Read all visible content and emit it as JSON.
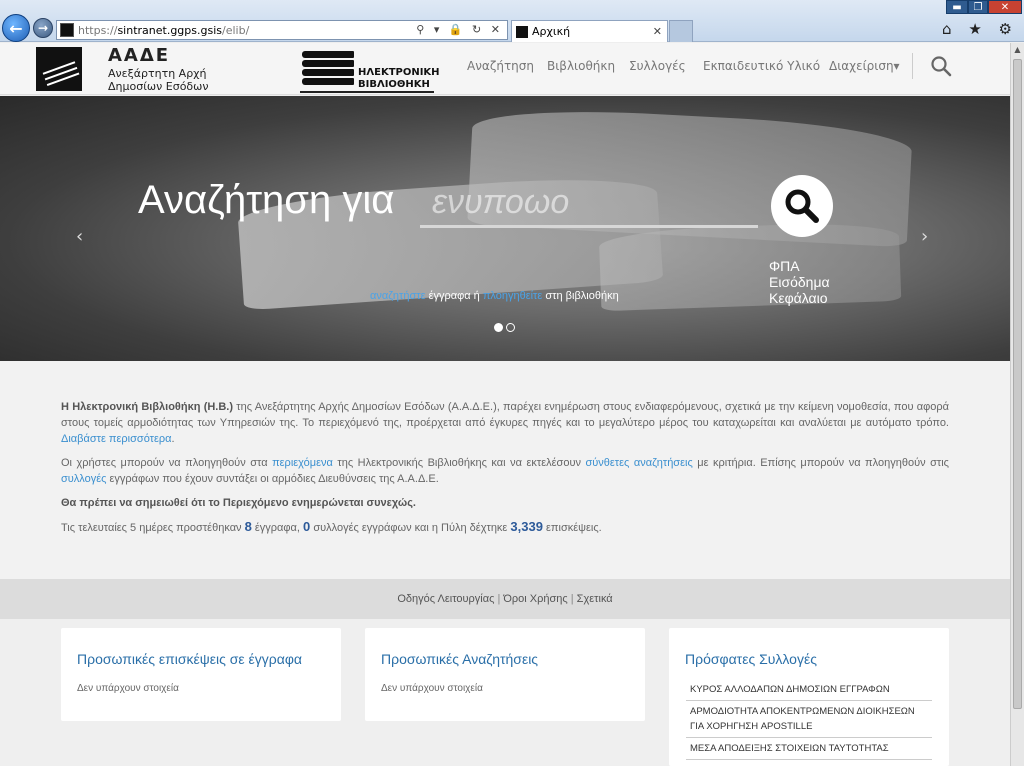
{
  "browser": {
    "url_prefix": "https://",
    "url_host": "sintranet.ggps.gsis",
    "url_path": "/elib/",
    "tab_title": "Αρχική",
    "address_icons": "⚲ ▾ 🔒 ↻ ✕",
    "tab_close": "✕",
    "win_min": "▬",
    "win_max": "❐",
    "win_close": "✕",
    "right_icons": "⌂ ★ ⚙",
    "back_glyph": "←",
    "fwd_glyph": "→"
  },
  "header": {
    "org_abbr": "ΑΑΔΕ",
    "org_name": "Ανεξάρτητη Αρχή Δημοσίων Εσόδων",
    "elib_line1": "ΗΛΕΚΤΡΟΝΙΚΗ",
    "elib_line2": "ΒΙΒΛΙΟΘΗΚΗ",
    "nav": [
      {
        "label": "Αναζήτηση"
      },
      {
        "label": "Βιβλιοθήκη"
      },
      {
        "label": "Συλλογές"
      },
      {
        "label": "Εκπαιδευτικό Υλικό"
      },
      {
        "label": "Διαχείριση"
      }
    ],
    "admin_caret": "▾"
  },
  "hero": {
    "heading": "Αναζήτηση για",
    "input_placeholder": "ενυποωο",
    "tags": [
      "ΦΠΑ",
      "Εισόδημα",
      "Κεφάλαιο"
    ],
    "sub_link1": "αναζητήστε",
    "sub_mid": "έγγραφα ή",
    "sub_link2": "πλοηγηθείτε",
    "sub_end": "στη βιβλιοθήκη",
    "prev": "‹",
    "next": "›",
    "slide_count": 2,
    "active_slide": 1
  },
  "intro": {
    "p1_bold": "Η Ηλεκτρονική Βιβλιοθήκη (Η.Β.)",
    "p1_text": " της Ανεξάρτητης Αρχής Δημοσίων Εσόδων (Α.Α.Δ.Ε.), παρέχει ενημέρωση στους ενδιαφερόμενους, σχετικά με την κείμενη νομοθεσία, που αφορά στους τομείς αρμοδιότητας των Υπηρεσιών της. Το περιεχόμενό της, προέρχεται από έγκυρες πηγές και το μεγαλύτερο μέρος του καταχωρείται και αναλύεται με αυτόματο τρόπο.",
    "p1_link": "Διαβάστε περισσότερα",
    "p1_end": ".",
    "p2_a": "Οι χρήστες μπορούν να πλοηγηθούν στα ",
    "p2_link1": "περιεχόμενα",
    "p2_b": " της Ηλεκτρονικής Βιβλιοθήκης και να εκτελέσουν ",
    "p2_link2": "σύνθετες αναζητήσεις",
    "p2_c": " με κριτήρια. Επίσης μπορούν να πλοηγηθούν στις ",
    "p2_link3": "συλλογές",
    "p2_d": " εγγράφων που έχουν συντάξει οι αρμόδιες Διευθύνσεις της Α.Α.Δ.Ε.",
    "p3_bold": "Θα πρέπει να σημειωθεί ότι το Περιεχόμενο ενημερώνεται συνεχώς.",
    "p4_a": "Τις τελευταίες 5 ημέρες προστέθηκαν ",
    "docs_added": "8",
    "p4_b": " έγγραφα, ",
    "collections_added": "0",
    "p4_c": " συλλογές εγγράφων και η Πύλη δέχτηκε ",
    "visits": "3,339",
    "p4_d": " επισκέψεις."
  },
  "footer_links": {
    "guide": "Οδηγός Λειτουργίας",
    "terms": "Όροι Χρήσης",
    "about": "Σχετικά",
    "sep": "|"
  },
  "cards": {
    "visits_title": "Προσωπικές επισκέψεις σε έγγραφα",
    "visits_empty": "Δεν υπάρχουν στοιχεία",
    "searches_title": "Προσωπικές Αναζητήσεις",
    "searches_empty": "Δεν υπάρχουν στοιχεία",
    "recent_title": "Πρόσφατες Συλλογές",
    "recent_items": [
      {
        "label": "ΚΥΡΟΣ ΑΛΛΟΔΑΠΩΝ ΔΗΜΟΣΙΩΝ ΕΓΓΡΑΦΩΝ"
      },
      {
        "label": "ΑΡΜΟΔΙΟΤΗΤΑ ΑΠΟΚΕΝΤΡΩΜΕΝΩΝ ΔΙΟΙΚΗΣΕΩΝ ΓΙΑ ΧΟΡΗΓΗΣΗ APOSTILLE"
      },
      {
        "label": "ΜΕΣΑ ΑΠΟΔΕΙΞΗΣ ΣΤΟΙΧΕΙΩΝ ΤΑΥΤΟΤΗΤΑΣ"
      }
    ]
  }
}
